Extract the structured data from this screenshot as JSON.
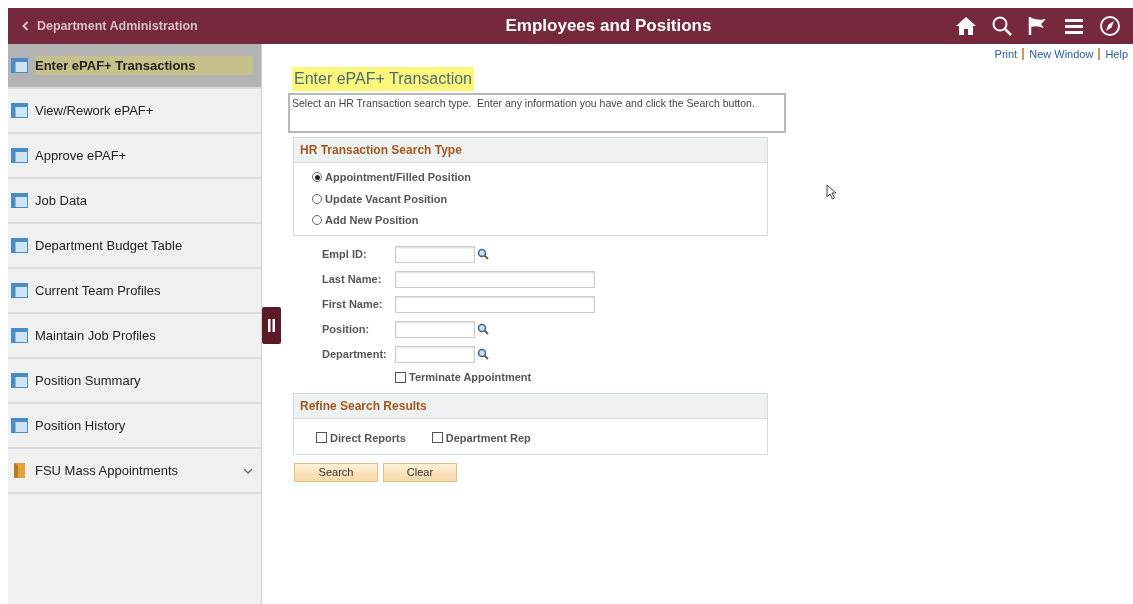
{
  "header": {
    "back_label": "Department Administration",
    "title": "Employees and Positions"
  },
  "sidebar": {
    "items": [
      {
        "label": "Enter ePAF+ Transactions",
        "kind": "page",
        "selected": true
      },
      {
        "label": "View/Rework ePAF+",
        "kind": "page",
        "selected": false
      },
      {
        "label": "Approve ePAF+",
        "kind": "page",
        "selected": false
      },
      {
        "label": "Job Data",
        "kind": "page",
        "selected": false
      },
      {
        "label": "Department Budget Table",
        "kind": "page",
        "selected": false
      },
      {
        "label": "Current Team Profiles",
        "kind": "page",
        "selected": false
      },
      {
        "label": "Maintain Job Profiles",
        "kind": "page",
        "selected": false
      },
      {
        "label": "Position Summary",
        "kind": "page",
        "selected": false
      },
      {
        "label": "Position History",
        "kind": "page",
        "selected": false
      },
      {
        "label": "FSU Mass Appointments",
        "kind": "folder",
        "selected": false,
        "expanded": false
      }
    ]
  },
  "page_links": [
    "Print",
    "New Window",
    "Help"
  ],
  "page_title": "Enter ePAF+ Transaction",
  "instructions": "Select an HR Transaction search type.  Enter any information you have and click the Search button.",
  "search_type": {
    "title": "HR Transaction Search Type",
    "options": [
      {
        "label": "Appointment/Filled Position",
        "selected": true
      },
      {
        "label": "Update Vacant Position",
        "selected": false
      },
      {
        "label": "Add New Position",
        "selected": false
      }
    ]
  },
  "fields": [
    {
      "label": "Empl ID:",
      "kind": "lookup"
    },
    {
      "label": "Last Name:",
      "kind": "text"
    },
    {
      "label": "First Name:",
      "kind": "text"
    },
    {
      "label": "Position:",
      "kind": "lookup"
    },
    {
      "label": "Department:",
      "kind": "lookup"
    }
  ],
  "terminate": {
    "label": "Terminate Appointment",
    "checked": false
  },
  "refine": {
    "title": "Refine Search Results",
    "options": [
      {
        "label": "Direct Reports",
        "checked": false
      },
      {
        "label": "Department Rep",
        "checked": false
      }
    ]
  },
  "buttons": [
    "Search",
    "Clear"
  ]
}
